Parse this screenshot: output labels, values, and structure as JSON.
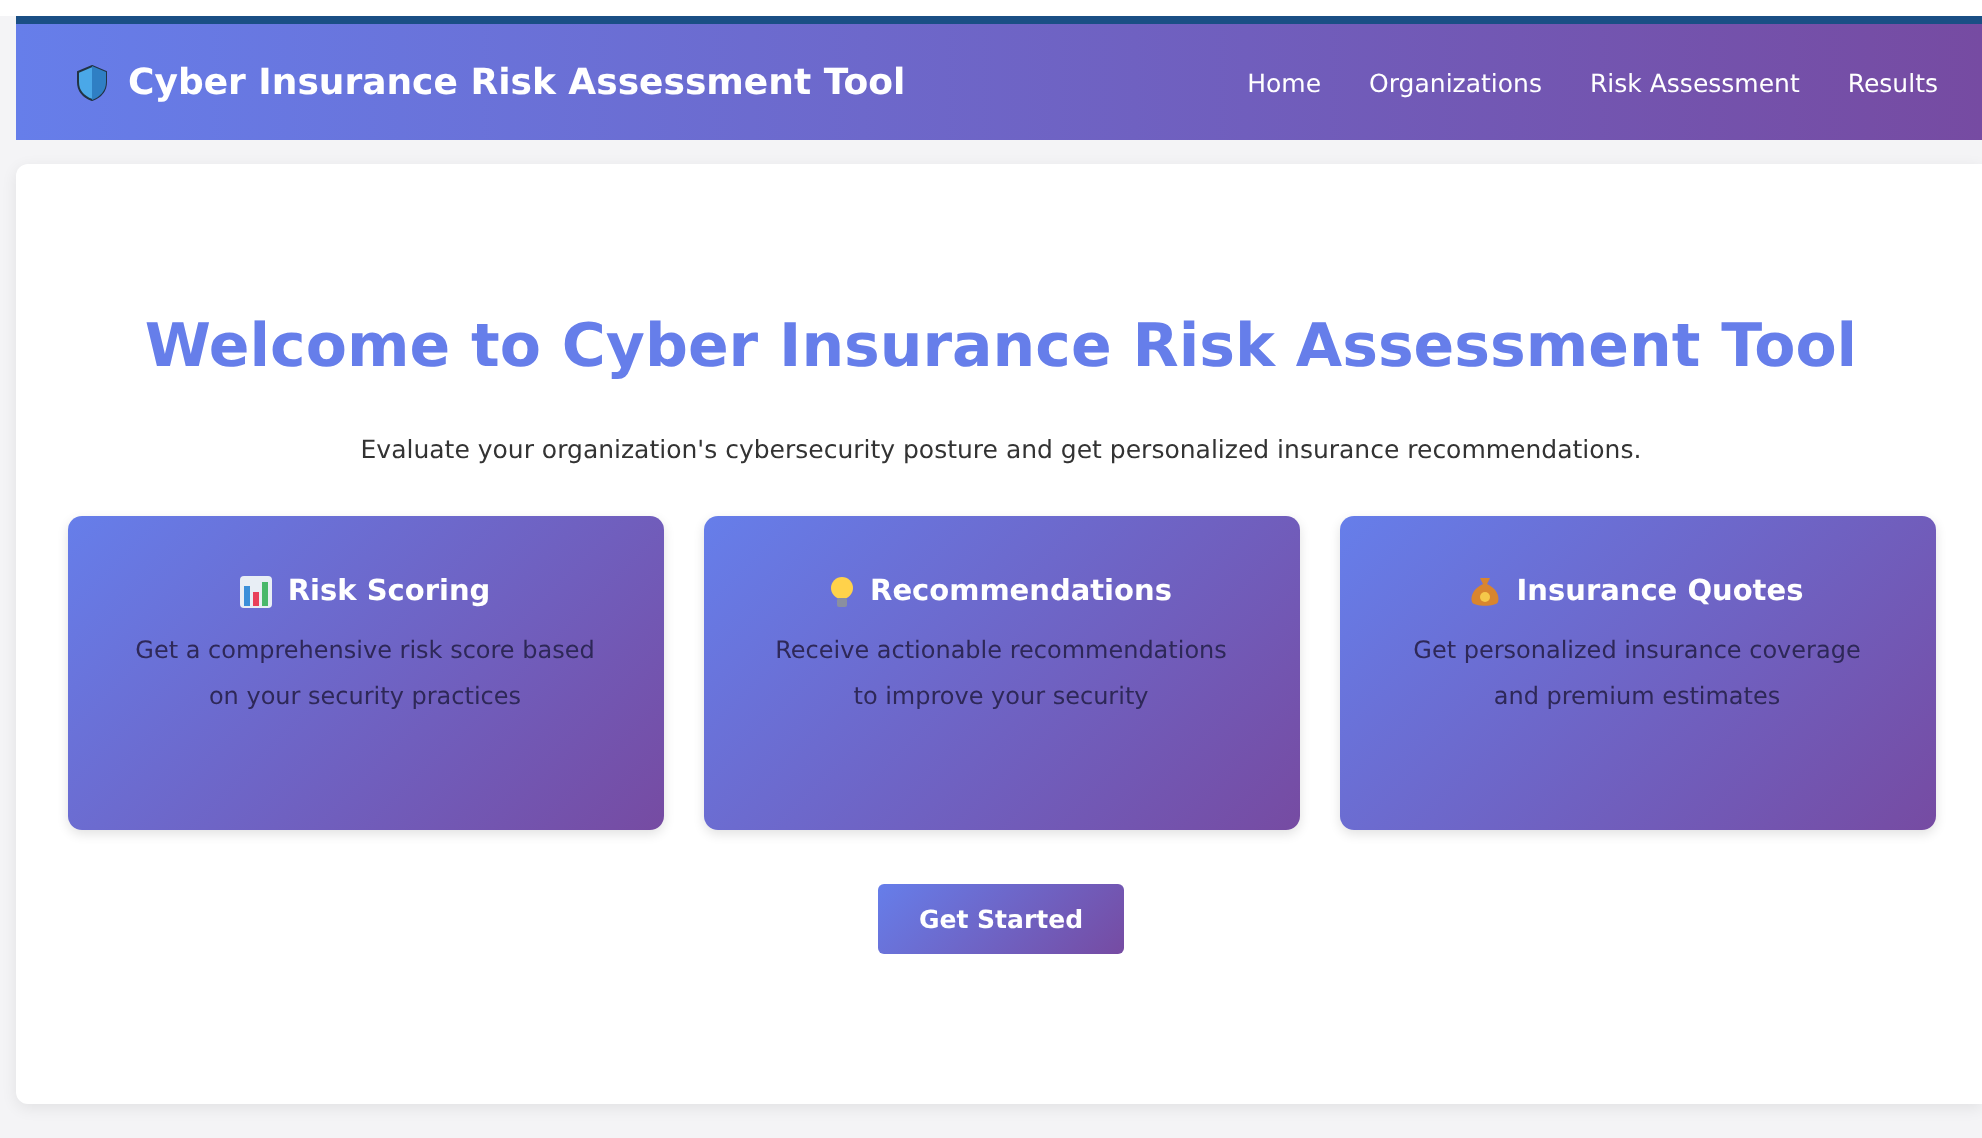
{
  "header": {
    "title": "Cyber Insurance Risk Assessment Tool",
    "nav": [
      {
        "label": "Home"
      },
      {
        "label": "Organizations"
      },
      {
        "label": "Risk Assessment"
      },
      {
        "label": "Results"
      }
    ]
  },
  "hero": {
    "title": "Welcome to Cyber Insurance Risk Assessment Tool",
    "subtitle": "Evaluate your organization's cybersecurity posture and get personalized insurance recommendations."
  },
  "features": [
    {
      "kind": "chart",
      "title": "Risk Scoring",
      "text": "Get a comprehensive risk score based on your security practices"
    },
    {
      "kind": "bulb",
      "title": "Recommendations",
      "text": "Receive actionable recommendations to improve your security"
    },
    {
      "kind": "moneybag",
      "title": "Insurance Quotes",
      "text": "Get personalized insurance coverage and premium estimates"
    }
  ],
  "cta": {
    "label": "Get Started"
  }
}
